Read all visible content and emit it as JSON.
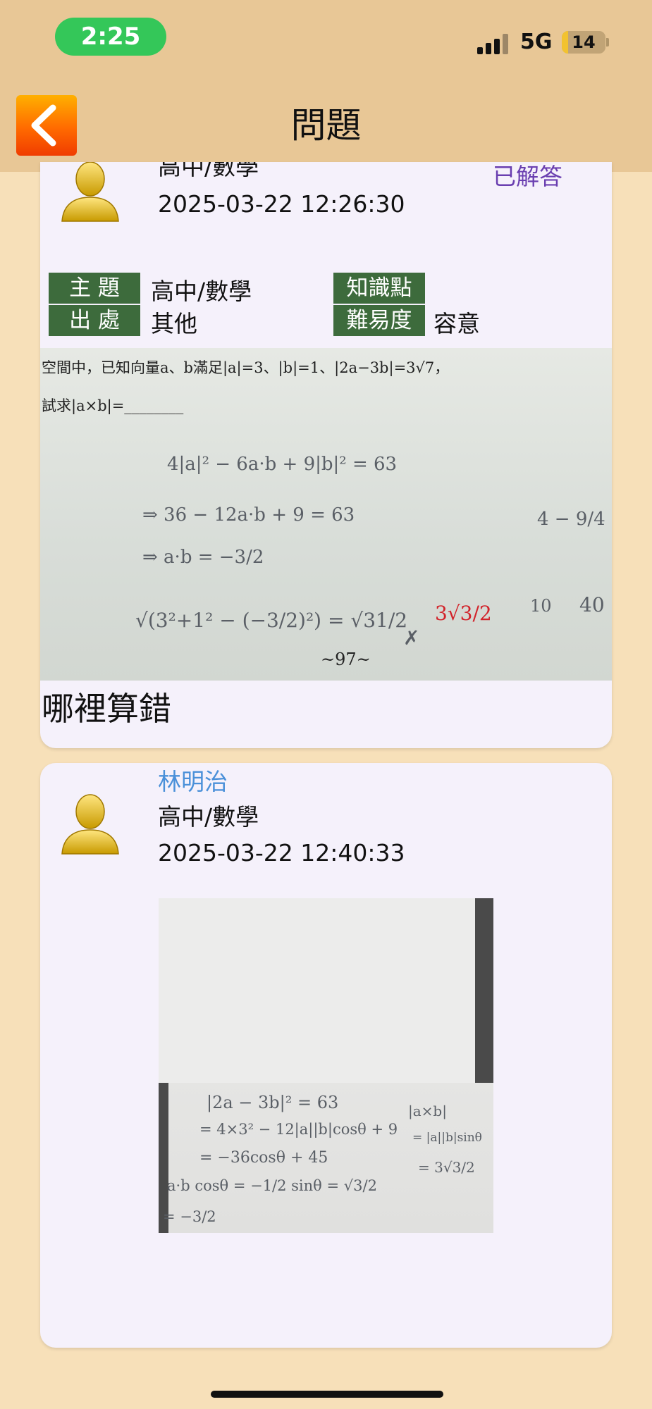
{
  "status_bar": {
    "time": "2:25",
    "network": "5G",
    "battery_level": "14",
    "battery_fraction": 0.14,
    "time_pill_color": "#34c759"
  },
  "nav": {
    "title": "問題",
    "back_icon": "chevron-left-icon",
    "back_color": "#ff6a00"
  },
  "posts": [
    {
      "subject_line": "高中/數學",
      "datetime": "2025-03-22 12:26:30",
      "status": "已解答",
      "labels": {
        "topic": "主  題",
        "source": "出  處",
        "knowledge": "知識點",
        "difficulty": "難易度"
      },
      "topic_value": "高中/數學",
      "source_value": "其他",
      "knowledge_value": "",
      "difficulty_value": "容意",
      "image": {
        "problem_line1": "空間中，已知向量a、b滿足|a|=3、|b|=1、|2a−3b|=3√7，",
        "problem_line2": "試求|a×b|=________",
        "work1": "4|a|² − 6a·b + 9|b|² = 63",
        "work2": "⇒ 36 − 12a·b + 9 = 63",
        "work3": "⇒ a·b = −3/2",
        "work4": "√(3²+1² − (−3/2)²) = √31/2",
        "cross": "✗",
        "answer_red": "3√3/2",
        "side1": "4 − 9/4",
        "side2": "10",
        "side3": "40",
        "page_number": "~97~"
      },
      "question": "哪裡算錯"
    },
    {
      "asker": "林明治",
      "subject_line": "高中/數學",
      "datetime": "2025-03-22 12:40:33",
      "image": {
        "line1": "|2a − 3b|² = 63",
        "line2": "= 4×3² − 12|a||b|cosθ + 9",
        "line3": "= −36cosθ + 45",
        "line4": "a·b    cosθ = −1/2    sinθ = √3/2",
        "line5": "= −3/2",
        "side1": "|a×b|",
        "side2": "= |a||b|sinθ",
        "side3": "= 3√3/2"
      }
    }
  ]
}
